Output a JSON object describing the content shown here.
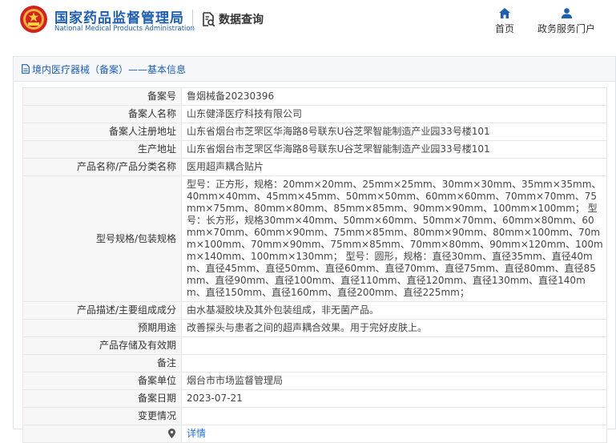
{
  "header": {
    "logo_cn": "国家药品监督管理局",
    "logo_en": "National Medical Products Administration",
    "data_query": "数据查询",
    "nav": {
      "home": "首页",
      "service": "政务服务门户"
    }
  },
  "panel": {
    "title": "境内医疗器械（备案）——基本信息"
  },
  "rows": [
    {
      "label": "备案号",
      "value": "鲁烟械备20230396"
    },
    {
      "label": "备案人名称",
      "value": "山东健泽医疗科技有限公司"
    },
    {
      "label": "备案人注册地址",
      "value": "山东省烟台市芝罘区华海路8号联东U谷芝罘智能制造产业园33号楼101"
    },
    {
      "label": "生产地址",
      "value": "山东省烟台市芝罘区华海路8号联东U谷芝罘智能制造产业园33号楼101"
    },
    {
      "label": "产品名称/产品分类名称",
      "value": "医用超声耦合贴片"
    },
    {
      "label": "型号规格/包装规格",
      "value": "型号：正方形，规格：20mm×20mm、25mm×25mm、30mm×30mm、35mm×35mm、40mm×40mm、45mm×45mm、50mm×50mm、60mm×60mm、70mm×70mm、75mm×75mm、80mm×80mm、85mm×85mm、90mm×90mm、100mm×100mm； 型号：长方形，规格30mm×40mm、50mm×60mm、50mm×70mm、60mm×80mm、60mm×70mm、60mm×90mm、75mm×85mm、80mm×90mm、80mm×100mm、70mm×100mm、70mm×90mm、75mm×85mm、70mm×80mm、90mm×120mm、100mm×140mm、100mm×130mm； 型号：圆形，规格：直径30mm、直径35mm、直径40mm、直径45mm、直径50mm、直径60mm、直径70mm、直径75mm、直径80mm、直径85mm、直径90mm、直径100mm、直径110mm、直径120mm、直径130mm、直径140mm、直径150mm、直径160mm、直径200mm、直径225mm；"
    },
    {
      "label": "产品描述/主要组成成分",
      "value": "由水基凝胶块及其外包装组成，非无菌产品。"
    },
    {
      "label": "预期用途",
      "value": "改善探头与患者之间的超声耦合效果。用于完好皮肤上。"
    },
    {
      "label": "产品存储及有效期",
      "value": ""
    },
    {
      "label": "备注",
      "value": ""
    },
    {
      "label": "备案单位",
      "value": "烟台市市场监督管理局"
    },
    {
      "label": "备案日期",
      "value": "2023-07-21"
    },
    {
      "label": "变更情况",
      "value": ""
    }
  ],
  "last_row": {
    "label": "",
    "link": "详情"
  },
  "icons": {
    "emblem": "national-emblem-icon",
    "search": "document-search-icon",
    "home": "home-icon",
    "user": "user-icon",
    "doc": "document-icon",
    "pin": "map-pin-icon"
  },
  "colors": {
    "brand": "#1f5fae",
    "link": "#1f6fd1",
    "label_bg": "#f7f7f7"
  }
}
